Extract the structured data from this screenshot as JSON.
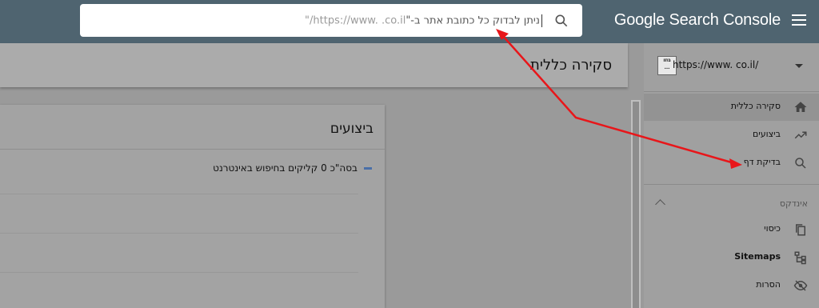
{
  "app": {
    "brand": "Google Search Console"
  },
  "search": {
    "text": "ניתן לבדוק כל כתובת אתר ב-\"",
    "url_text": "https://www.          .co.il/\""
  },
  "header": {
    "title": "סקירה כללית"
  },
  "property": {
    "logo_text": "גוזו ...",
    "url": "https://www.        co.il/"
  },
  "sidebar": {
    "items": [
      {
        "label": "סקירה כללית",
        "icon": "home-icon",
        "active": true
      },
      {
        "label": "ביצועים",
        "icon": "trending-up-icon",
        "active": false
      },
      {
        "label": "בדיקת דף",
        "icon": "search-icon",
        "active": false
      }
    ],
    "index_section": "אינדקס",
    "index_items": [
      {
        "label": "כיסוי",
        "icon": "copy-icon"
      },
      {
        "label": "Sitemaps",
        "icon": "sitemap-icon"
      },
      {
        "label": "הסרות",
        "icon": "eye-off-icon"
      }
    ]
  },
  "card": {
    "title": "ביצועים",
    "legend": "בסה\"כ 0 קליקים בחיפוש באינטרנט",
    "legend_color": "#4a6fa8"
  },
  "colors": {
    "topbar": "#4f6470",
    "arrow": "#e8161a"
  }
}
